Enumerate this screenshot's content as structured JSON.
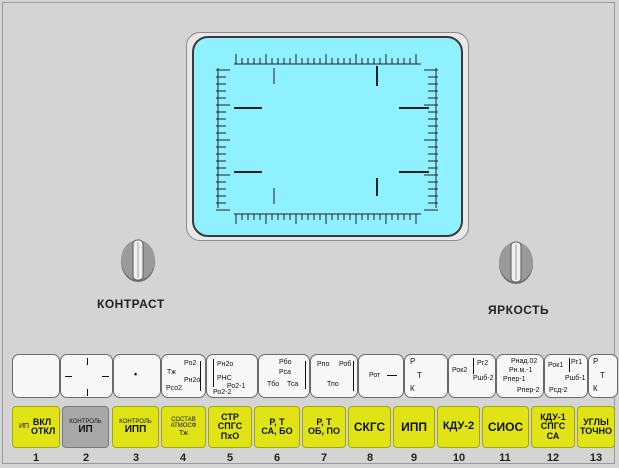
{
  "knobs": {
    "contrast_label": "КОНТРАСТ",
    "brightness_label": "ЯРКОСТЬ"
  },
  "indicators": {
    "i3": "•",
    "i4": [
      "Тж",
      "Рo2",
      "Рсо2",
      "Рн2о"
    ],
    "i5": [
      "Рн2о",
      "РНС",
      "Ро2-1",
      "Ро2-2"
    ],
    "i6": [
      "Рбо",
      "Рса",
      "Тбо",
      "Тса"
    ],
    "i7": [
      "Рпо",
      "Роб",
      "Тпо"
    ],
    "i8": "Рот",
    "i9": [
      "Р",
      "Т",
      "К"
    ],
    "i10": [
      "Рок2",
      "Рг2",
      "Ршб-2"
    ],
    "i11": [
      "Рнад.02",
      "Рн.м.-1",
      "Рпер-1",
      "Рпер-2"
    ],
    "i12": [
      "Рок1",
      "Рг1",
      "Ршб-1",
      "Рсд-2"
    ],
    "i13": [
      "Р",
      "Т",
      "К"
    ]
  },
  "buttons": [
    {
      "num": "1",
      "small": "ИП",
      "label": "ВКЛ ОТКЛ"
    },
    {
      "num": "2",
      "small": "КОНТРОЛЬ",
      "label": "ИП"
    },
    {
      "num": "3",
      "small": "КОНТРОЛЬ",
      "label": "ИПП"
    },
    {
      "num": "4",
      "small": "СОСТАВ АТМОСФ",
      "label": "Тж"
    },
    {
      "num": "5",
      "small": "",
      "label": "СТР СПГС ПхО"
    },
    {
      "num": "6",
      "small": "",
      "label": "Р, Т СА, БО"
    },
    {
      "num": "7",
      "small": "",
      "label": "Р, Т ОБ, ПО"
    },
    {
      "num": "8",
      "small": "",
      "label": "СКГС"
    },
    {
      "num": "9",
      "small": "",
      "label": "ИПП"
    },
    {
      "num": "10",
      "small": "",
      "label": "КДУ-2"
    },
    {
      "num": "11",
      "small": "",
      "label": "СИОС"
    },
    {
      "num": "12",
      "small": "",
      "label": "КДУ-1 СПГС СА"
    },
    {
      "num": "13",
      "small": "",
      "label": "УГЛЫ ТОЧНО"
    }
  ],
  "colors": {
    "screen": "#8ff0ff",
    "button": "#e0e416",
    "button_pressed": "#a8a8a8",
    "panel": "#d4d4d4"
  }
}
